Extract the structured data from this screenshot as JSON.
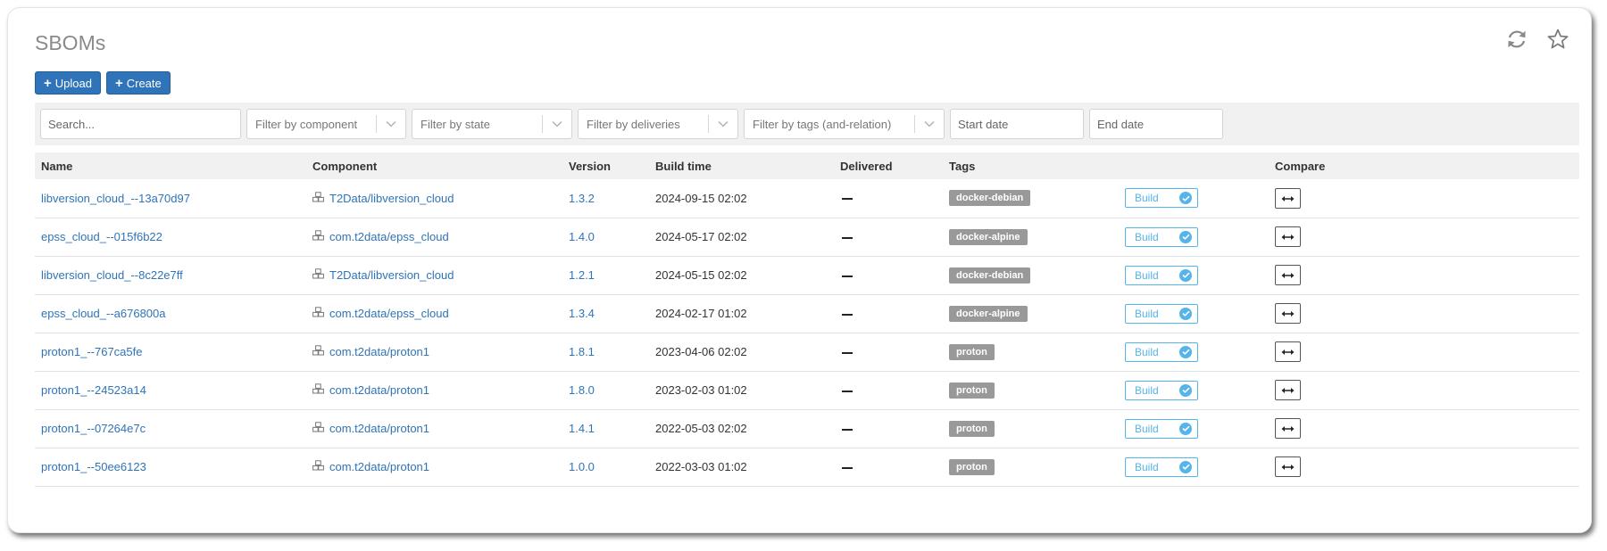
{
  "page": {
    "title": "SBOMs"
  },
  "toolbar": {
    "upload_label": "Upload",
    "create_label": "Create"
  },
  "filters": {
    "search_placeholder": "Search...",
    "component_placeholder": "Filter by component",
    "state_placeholder": "Filter by state",
    "deliveries_placeholder": "Filter by deliveries",
    "tags_placeholder": "Filter by tags (and-relation)",
    "start_date_placeholder": "Start date",
    "end_date_placeholder": "End date"
  },
  "table": {
    "headers": {
      "name": "Name",
      "component": "Component",
      "version": "Version",
      "build_time": "Build time",
      "delivered": "Delivered",
      "tags": "Tags",
      "state": "",
      "compare": "Compare"
    },
    "rows": [
      {
        "name": "libversion_cloud_--13a70d97",
        "component": "T2Data/libversion_cloud",
        "version": "1.3.2",
        "build_time": "2024-09-15 02:02",
        "delivered": "",
        "tag": "docker-debian",
        "state": "Build"
      },
      {
        "name": "epss_cloud_--015f6b22",
        "component": "com.t2data/epss_cloud",
        "version": "1.4.0",
        "build_time": "2024-05-17 02:02",
        "delivered": "",
        "tag": "docker-alpine",
        "state": "Build"
      },
      {
        "name": "libversion_cloud_--8c22e7ff",
        "component": "T2Data/libversion_cloud",
        "version": "1.2.1",
        "build_time": "2024-05-15 02:02",
        "delivered": "",
        "tag": "docker-debian",
        "state": "Build"
      },
      {
        "name": "epss_cloud_--a676800a",
        "component": "com.t2data/epss_cloud",
        "version": "1.3.4",
        "build_time": "2024-02-17 01:02",
        "delivered": "",
        "tag": "docker-alpine",
        "state": "Build"
      },
      {
        "name": "proton1_--767ca5fe",
        "component": "com.t2data/proton1",
        "version": "1.8.1",
        "build_time": "2023-04-06 02:02",
        "delivered": "",
        "tag": "proton",
        "state": "Build"
      },
      {
        "name": "proton1_--24523a14",
        "component": "com.t2data/proton1",
        "version": "1.8.0",
        "build_time": "2023-02-03 01:02",
        "delivered": "",
        "tag": "proton",
        "state": "Build"
      },
      {
        "name": "proton1_--07264e7c",
        "component": "com.t2data/proton1",
        "version": "1.4.1",
        "build_time": "2022-05-03 02:02",
        "delivered": "",
        "tag": "proton",
        "state": "Build"
      },
      {
        "name": "proton1_--50ee6123",
        "component": "com.t2data/proton1",
        "version": "1.0.0",
        "build_time": "2022-03-03 01:02",
        "delivered": "",
        "tag": "proton",
        "state": "Build"
      }
    ]
  },
  "icons": {
    "refresh": "refresh-icon",
    "favorite": "star-icon",
    "component": "cubes-icon",
    "dropdown": "chevron-down-icon",
    "state_check": "check-circle-icon",
    "compare": "arrows-horizontal-icon"
  },
  "colors": {
    "primary": "#2f74b8",
    "link": "#2f74b8",
    "tag_bg": "#999999",
    "build_badge": "#55b4e9",
    "title": "#8a8a8a"
  }
}
